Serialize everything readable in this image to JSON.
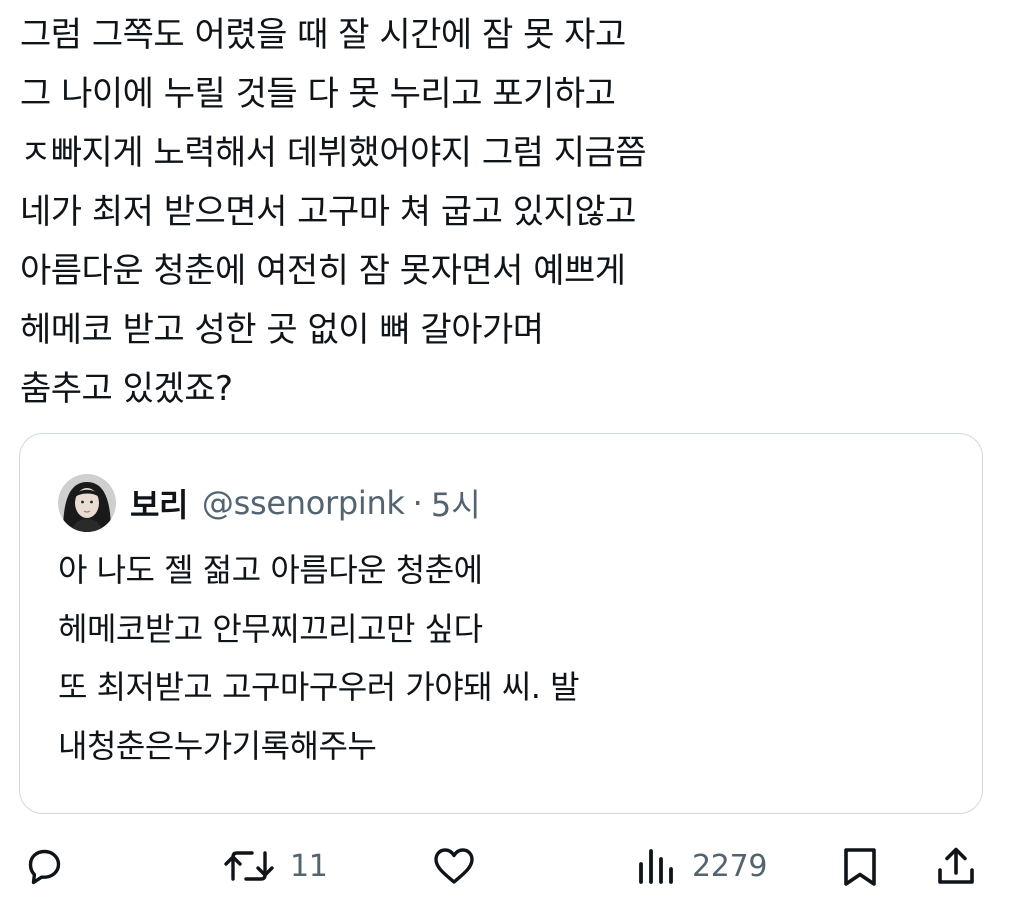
{
  "tweet": {
    "text_lines": [
      "그럼 그쪽도 어렸을 때 잘 시간에 잠 못 자고",
      "그 나이에 누릴 것들 다 못 누리고 포기하고",
      "ㅈ빠지게 노력해서 데뷔했어야지 그럼 지금쯤",
      "네가 최저 받으면서 고구마 쳐 굽고 있지않고",
      "아름다운 청춘에 여전히 잠 못자면서 예쁘게",
      "헤메코 받고 성한 곳 없이 뼈 갈아가며",
      "춤추고 있겠죠?"
    ]
  },
  "quoted": {
    "author_name": "보리",
    "handle": "@ssenorpink",
    "separator": "·",
    "time": "5시",
    "avatar_icon": "profile-photo-avatar",
    "text_lines": [
      "아 나도 젤 젊고 아름다운 청춘에",
      "헤메코받고 안무찌끄리고만 싶다",
      "또 최저받고 고구마구우러 가야돼 씨. 발",
      "내청춘은누가기록해주누"
    ]
  },
  "actions": {
    "reply_icon": "reply-icon",
    "retweet_icon": "retweet-icon",
    "retweet_count": "11",
    "like_icon": "heart-icon",
    "views_icon": "views-chart-icon",
    "views_count": "2279",
    "bookmark_icon": "bookmark-icon",
    "share_icon": "share-icon"
  },
  "colors": {
    "text": "#0f1419",
    "secondary": "#536471",
    "border": "#cfd9de",
    "background": "#ffffff"
  }
}
